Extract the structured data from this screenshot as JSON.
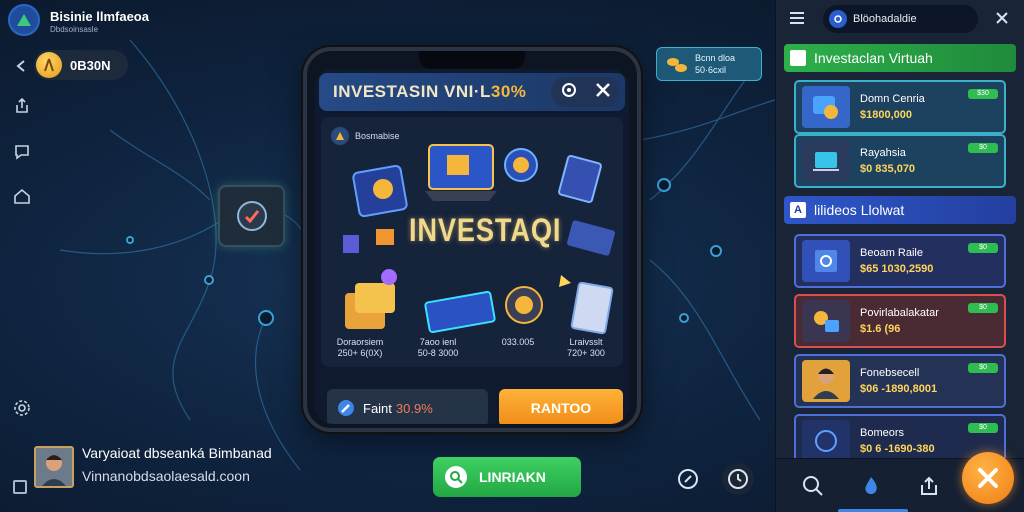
{
  "app": {
    "title": "Bisinie llmfaeoa",
    "subtitle": "Dbdsoinsasle"
  },
  "toolbar": {
    "coin_value": "0B30N"
  },
  "badge": {
    "line1": "Bcnn dloa",
    "line2": "50·6cxil"
  },
  "modal": {
    "title_main": "INVESTASIN VNI·L",
    "title_highlight": "30%",
    "section_label": "Bosmabise",
    "hero_text": "INVESTAQI",
    "stats": [
      {
        "line1": "Doraorsiem",
        "line2": "250+ 6(0X)"
      },
      {
        "line1": "7aoo ienl",
        "line2": "50-8 3000"
      },
      {
        "line1": "",
        "line2": "033.005"
      },
      {
        "line1": "Lraivsslt",
        "line2": "720+ 300"
      }
    ],
    "bottom_label": "Faint",
    "bottom_pct": "30.9%",
    "cta_label": "RANTOO"
  },
  "user": {
    "name": "Varyaioat dbseanká Bimbanad",
    "url": "Vinnanobdsaolaesald.coon"
  },
  "bottom_bar": {
    "green_label": "LINRIAKN"
  },
  "panel": {
    "search_text": "Blöohadaldie",
    "section1_title": "Investaclan Virtuah",
    "section1_box": "",
    "section2_title": "lilideos Llolwat",
    "section2_box": "A",
    "cards_top": [
      {
        "name": "Domn Cenria",
        "value": "$1800,000",
        "badge": "$30"
      },
      {
        "name": "Rayahsia",
        "value": "$0 835,070",
        "badge": "$0"
      }
    ],
    "cards_bottom": [
      {
        "name": "Beoam Raile",
        "value": "$65  1030,2590",
        "badge": "$0"
      },
      {
        "name": "Povirlabalakatar",
        "value": "$1.6 (96",
        "badge": "$0"
      },
      {
        "name": "Fonebsecell",
        "value": "$06 -1890,8001",
        "badge": "$0"
      },
      {
        "name": "Bomeors",
        "value": "$0 6 -1690-380",
        "badge": "$0"
      }
    ]
  },
  "colors": {
    "accent_orange": "#f59a1e",
    "accent_green": "#2fbd52",
    "panel_bg": "#1a2437",
    "phone_border": "#2b3442"
  }
}
